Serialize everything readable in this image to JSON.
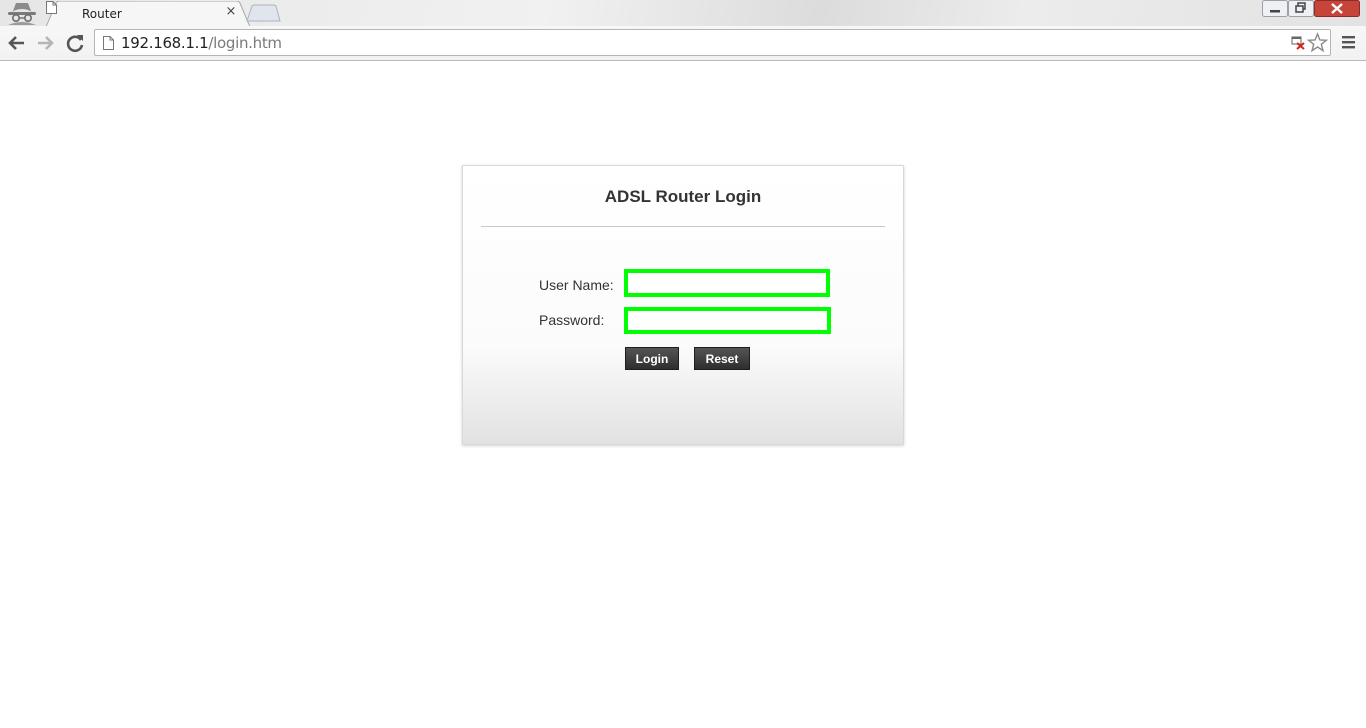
{
  "browser": {
    "tab_title": "Router",
    "tab_close_glyph": "×",
    "url_host": "192.168.1.1",
    "url_path": "/login.htm",
    "icons": {
      "incognito": "incognito-icon",
      "back": "back-arrow-icon",
      "forward": "forward-arrow-icon",
      "reload": "reload-icon",
      "page": "page-icon",
      "blocked": "popup-blocked-icon",
      "star": "bookmark-star-icon",
      "menu": "menu-icon"
    },
    "colors": {
      "close_button": "#c7443a"
    }
  },
  "login": {
    "title": "ADSL Router Login",
    "username_label": "User Name:",
    "password_label": "Password:",
    "username_value": "",
    "password_value": "",
    "login_button": "Login",
    "reset_button": "Reset",
    "highlight_color": "#00ff00"
  }
}
